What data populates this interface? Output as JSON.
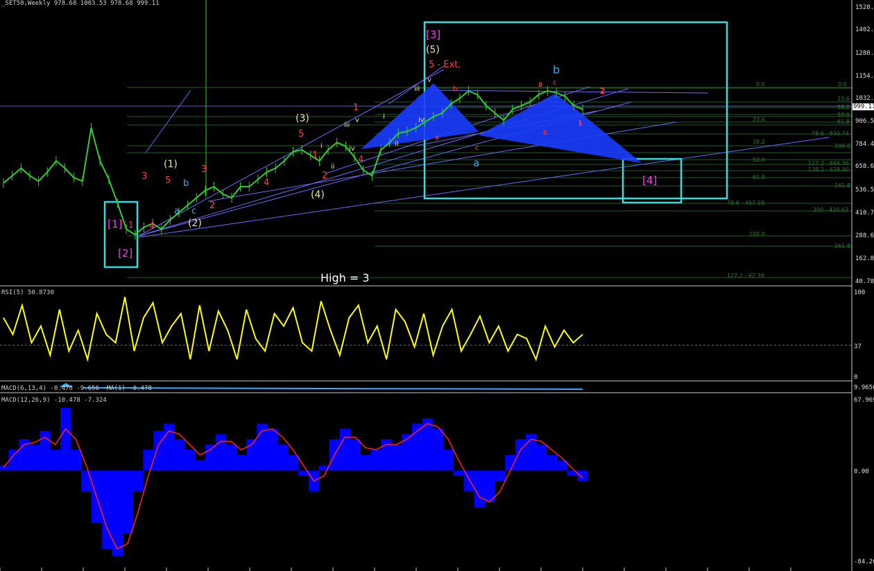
{
  "header": {
    "main": "_SET50,Weekly  978.68 1003.53 978.68 999.11",
    "rsi": "RSI(5) 50.8730",
    "macd_small": "MACD(6,13,4) -0.478 -9.656 -MA(1) -0.478",
    "macd": "MACD(12,26,9) -10.478 -7.324"
  },
  "price_axis": [
    "1528.1",
    "1402.3",
    "1280.2",
    "1154.4",
    "1032.3",
    "906.5",
    "784.4",
    "658.6",
    "536.5",
    "410.7",
    "288.6",
    "162.8",
    "40.78"
  ],
  "current_price": "999.11",
  "rsi_axis": [
    "100",
    "37",
    "0"
  ],
  "macd_small_axis": "9.9656",
  "macd_axis": [
    "67.969",
    "0.00",
    "-84.205"
  ],
  "colors": {
    "price": "#33cc33",
    "rsi": "#ffff00",
    "macd_hist": "#0000ff",
    "macd_signal": "#ff2020",
    "cyan": "#33dddd",
    "magenta": "#ff33ff",
    "fib": "#2e7a2e"
  },
  "fib_labels": [
    "0.0",
    "0.0",
    "23.6",
    "23.6",
    "38.2",
    "50.0",
    "61.8",
    "78.6 - 830.74",
    "38.2",
    "100.0",
    "50.0",
    "127.2 - 666.56",
    "138.2 - 629.40",
    "61.8",
    "161.8",
    "78.6 - 457.19",
    "200 - 420.62",
    "100.0",
    "261.8",
    "127.2 - 62.39"
  ],
  "wave_labels": [
    "[1]",
    "[2]",
    "[3]",
    "[4]",
    "(5)",
    "5 - Ext.",
    "b",
    "a",
    "(1)",
    "(2)",
    "(3)",
    "(4)",
    "3",
    "5",
    "1",
    "4",
    "2",
    "3",
    "5",
    "1",
    "2",
    "4",
    "1",
    "2",
    "4",
    "3",
    "5",
    "a",
    "b",
    "c",
    "i",
    "ii",
    "iii",
    "iv",
    "v",
    "i",
    "ii",
    "iii",
    "iv",
    "v",
    "a",
    "b",
    "c",
    "a",
    "b",
    "c",
    "1",
    "2"
  ],
  "annotation": "High = 3",
  "chart_data": [
    {
      "type": "line",
      "title": "_SET50,Weekly",
      "ylim": [
        40.78,
        1528.1
      ],
      "y_scale": "linear",
      "grid": false,
      "series": [
        {
          "values": [
            580,
            620,
            660,
            620,
            590,
            640,
            700,
            660,
            610,
            590,
            880,
            700,
            600,
            470,
            330,
            300,
            340,
            360,
            330,
            380,
            420,
            460,
            500,
            540,
            560,
            520,
            500,
            560,
            560,
            600,
            640,
            660,
            700,
            750,
            760,
            730,
            700,
            760,
            800,
            780,
            720,
            650,
            620,
            760,
            800,
            850,
            860,
            880,
            910,
            940,
            960,
            1010,
            1040,
            1080,
            1060,
            1000,
            960,
            920,
            980,
            1000,
            1020,
            1060,
            1080,
            1070,
            1050,
            1000,
            980
          ]
        }
      ]
    },
    {
      "type": "line",
      "title": "RSI(5) 50.8730",
      "ylim": [
        0,
        100
      ],
      "series": [
        {
          "values": [
            70,
            50,
            85,
            40,
            60,
            25,
            80,
            30,
            55,
            20,
            75,
            50,
            40,
            95,
            30,
            70,
            88,
            40,
            60,
            75,
            20,
            85,
            30,
            78,
            55,
            20,
            80,
            45,
            30,
            75,
            60,
            82,
            40,
            30,
            90,
            55,
            25,
            70,
            85,
            40,
            60,
            20,
            80,
            65,
            35,
            75,
            25,
            60,
            80,
            30,
            50,
            72,
            40,
            60,
            30,
            50,
            45,
            20,
            60,
            35,
            55,
            40,
            50
          ]
        }
      ]
    },
    {
      "type": "bar",
      "title": "MACD(12,26,9) -10.478 -7.324",
      "ylim": [
        -84.205,
        67.969
      ],
      "series": [
        {
          "name": "MACD",
          "values": [
            5,
            20,
            30,
            25,
            38,
            20,
            60,
            20,
            -20,
            -50,
            -75,
            -82,
            -60,
            -20,
            20,
            38,
            45,
            30,
            20,
            10,
            25,
            35,
            25,
            15,
            30,
            45,
            40,
            25,
            15,
            -5,
            -20,
            5,
            30,
            40,
            30,
            15,
            20,
            30,
            25,
            35,
            45,
            50,
            40,
            20,
            -5,
            -20,
            -35,
            -30,
            -10,
            15,
            30,
            35,
            25,
            15,
            10,
            -5,
            -10
          ]
        },
        {
          "name": "Signal",
          "values": [
            3,
            15,
            25,
            27,
            32,
            25,
            40,
            30,
            5,
            -25,
            -55,
            -75,
            -70,
            -40,
            -5,
            25,
            38,
            35,
            25,
            15,
            20,
            28,
            28,
            20,
            25,
            38,
            40,
            32,
            20,
            5,
            -10,
            -5,
            15,
            32,
            32,
            22,
            20,
            25,
            25,
            30,
            38,
            45,
            42,
            30,
            10,
            -8,
            -25,
            -30,
            -20,
            0,
            20,
            30,
            28,
            20,
            12,
            2,
            -7
          ]
        }
      ]
    }
  ]
}
